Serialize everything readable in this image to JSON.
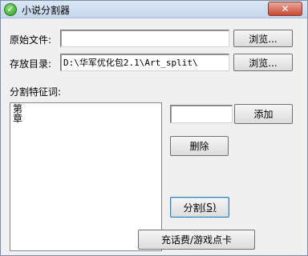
{
  "window": {
    "title": "小说分割器",
    "close_label": "✕",
    "app_icon_glyph": "✓"
  },
  "source": {
    "label": "原始文件:",
    "value": "",
    "browse_label": "浏览..."
  },
  "dest": {
    "label": "存放目录:",
    "value": "D:\\华军优化包2.1\\Art_split\\",
    "browse_label": "浏览..."
  },
  "keywords": {
    "label": "分割特征词:",
    "items": [
      "第",
      "章"
    ],
    "add_input_value": "",
    "add_label": "添加",
    "delete_label": "删除"
  },
  "split": {
    "label": "分割",
    "accel": "(S)"
  },
  "recharge": {
    "label": "充话费/游戏点卡"
  }
}
